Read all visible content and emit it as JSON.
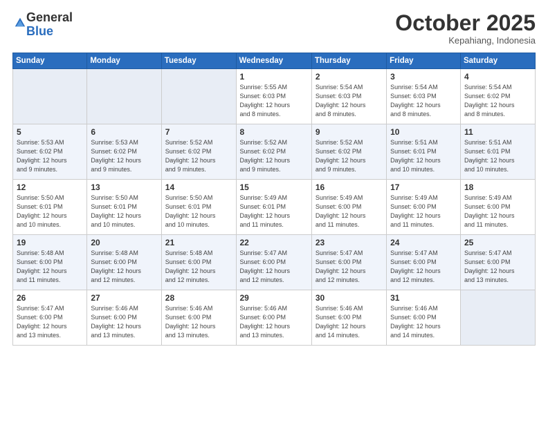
{
  "header": {
    "logo_general": "General",
    "logo_blue": "Blue",
    "month": "October 2025",
    "location": "Kepahiang, Indonesia"
  },
  "weekdays": [
    "Sunday",
    "Monday",
    "Tuesday",
    "Wednesday",
    "Thursday",
    "Friday",
    "Saturday"
  ],
  "weeks": [
    [
      {
        "day": "",
        "info": ""
      },
      {
        "day": "",
        "info": ""
      },
      {
        "day": "",
        "info": ""
      },
      {
        "day": "1",
        "info": "Sunrise: 5:55 AM\nSunset: 6:03 PM\nDaylight: 12 hours\nand 8 minutes."
      },
      {
        "day": "2",
        "info": "Sunrise: 5:54 AM\nSunset: 6:03 PM\nDaylight: 12 hours\nand 8 minutes."
      },
      {
        "day": "3",
        "info": "Sunrise: 5:54 AM\nSunset: 6:03 PM\nDaylight: 12 hours\nand 8 minutes."
      },
      {
        "day": "4",
        "info": "Sunrise: 5:54 AM\nSunset: 6:02 PM\nDaylight: 12 hours\nand 8 minutes."
      }
    ],
    [
      {
        "day": "5",
        "info": "Sunrise: 5:53 AM\nSunset: 6:02 PM\nDaylight: 12 hours\nand 9 minutes."
      },
      {
        "day": "6",
        "info": "Sunrise: 5:53 AM\nSunset: 6:02 PM\nDaylight: 12 hours\nand 9 minutes."
      },
      {
        "day": "7",
        "info": "Sunrise: 5:52 AM\nSunset: 6:02 PM\nDaylight: 12 hours\nand 9 minutes."
      },
      {
        "day": "8",
        "info": "Sunrise: 5:52 AM\nSunset: 6:02 PM\nDaylight: 12 hours\nand 9 minutes."
      },
      {
        "day": "9",
        "info": "Sunrise: 5:52 AM\nSunset: 6:02 PM\nDaylight: 12 hours\nand 9 minutes."
      },
      {
        "day": "10",
        "info": "Sunrise: 5:51 AM\nSunset: 6:01 PM\nDaylight: 12 hours\nand 10 minutes."
      },
      {
        "day": "11",
        "info": "Sunrise: 5:51 AM\nSunset: 6:01 PM\nDaylight: 12 hours\nand 10 minutes."
      }
    ],
    [
      {
        "day": "12",
        "info": "Sunrise: 5:50 AM\nSunset: 6:01 PM\nDaylight: 12 hours\nand 10 minutes."
      },
      {
        "day": "13",
        "info": "Sunrise: 5:50 AM\nSunset: 6:01 PM\nDaylight: 12 hours\nand 10 minutes."
      },
      {
        "day": "14",
        "info": "Sunrise: 5:50 AM\nSunset: 6:01 PM\nDaylight: 12 hours\nand 10 minutes."
      },
      {
        "day": "15",
        "info": "Sunrise: 5:49 AM\nSunset: 6:01 PM\nDaylight: 12 hours\nand 11 minutes."
      },
      {
        "day": "16",
        "info": "Sunrise: 5:49 AM\nSunset: 6:00 PM\nDaylight: 12 hours\nand 11 minutes."
      },
      {
        "day": "17",
        "info": "Sunrise: 5:49 AM\nSunset: 6:00 PM\nDaylight: 12 hours\nand 11 minutes."
      },
      {
        "day": "18",
        "info": "Sunrise: 5:49 AM\nSunset: 6:00 PM\nDaylight: 12 hours\nand 11 minutes."
      }
    ],
    [
      {
        "day": "19",
        "info": "Sunrise: 5:48 AM\nSunset: 6:00 PM\nDaylight: 12 hours\nand 11 minutes."
      },
      {
        "day": "20",
        "info": "Sunrise: 5:48 AM\nSunset: 6:00 PM\nDaylight: 12 hours\nand 12 minutes."
      },
      {
        "day": "21",
        "info": "Sunrise: 5:48 AM\nSunset: 6:00 PM\nDaylight: 12 hours\nand 12 minutes."
      },
      {
        "day": "22",
        "info": "Sunrise: 5:47 AM\nSunset: 6:00 PM\nDaylight: 12 hours\nand 12 minutes."
      },
      {
        "day": "23",
        "info": "Sunrise: 5:47 AM\nSunset: 6:00 PM\nDaylight: 12 hours\nand 12 minutes."
      },
      {
        "day": "24",
        "info": "Sunrise: 5:47 AM\nSunset: 6:00 PM\nDaylight: 12 hours\nand 12 minutes."
      },
      {
        "day": "25",
        "info": "Sunrise: 5:47 AM\nSunset: 6:00 PM\nDaylight: 12 hours\nand 13 minutes."
      }
    ],
    [
      {
        "day": "26",
        "info": "Sunrise: 5:47 AM\nSunset: 6:00 PM\nDaylight: 12 hours\nand 13 minutes."
      },
      {
        "day": "27",
        "info": "Sunrise: 5:46 AM\nSunset: 6:00 PM\nDaylight: 12 hours\nand 13 minutes."
      },
      {
        "day": "28",
        "info": "Sunrise: 5:46 AM\nSunset: 6:00 PM\nDaylight: 12 hours\nand 13 minutes."
      },
      {
        "day": "29",
        "info": "Sunrise: 5:46 AM\nSunset: 6:00 PM\nDaylight: 12 hours\nand 13 minutes."
      },
      {
        "day": "30",
        "info": "Sunrise: 5:46 AM\nSunset: 6:00 PM\nDaylight: 12 hours\nand 14 minutes."
      },
      {
        "day": "31",
        "info": "Sunrise: 5:46 AM\nSunset: 6:00 PM\nDaylight: 12 hours\nand 14 minutes."
      },
      {
        "day": "",
        "info": ""
      }
    ]
  ]
}
